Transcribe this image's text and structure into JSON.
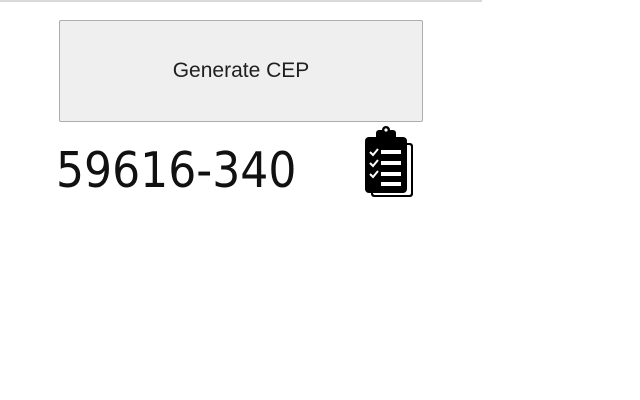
{
  "generate_button": {
    "label": "Generate CEP"
  },
  "result": {
    "cep": "59616-340"
  },
  "copy_button": {
    "icon": "clipboard-checklist-icon"
  },
  "colors": {
    "button_background": "#efefef",
    "button_border": "#adadad",
    "text": "#111111",
    "icon": "#000000"
  }
}
